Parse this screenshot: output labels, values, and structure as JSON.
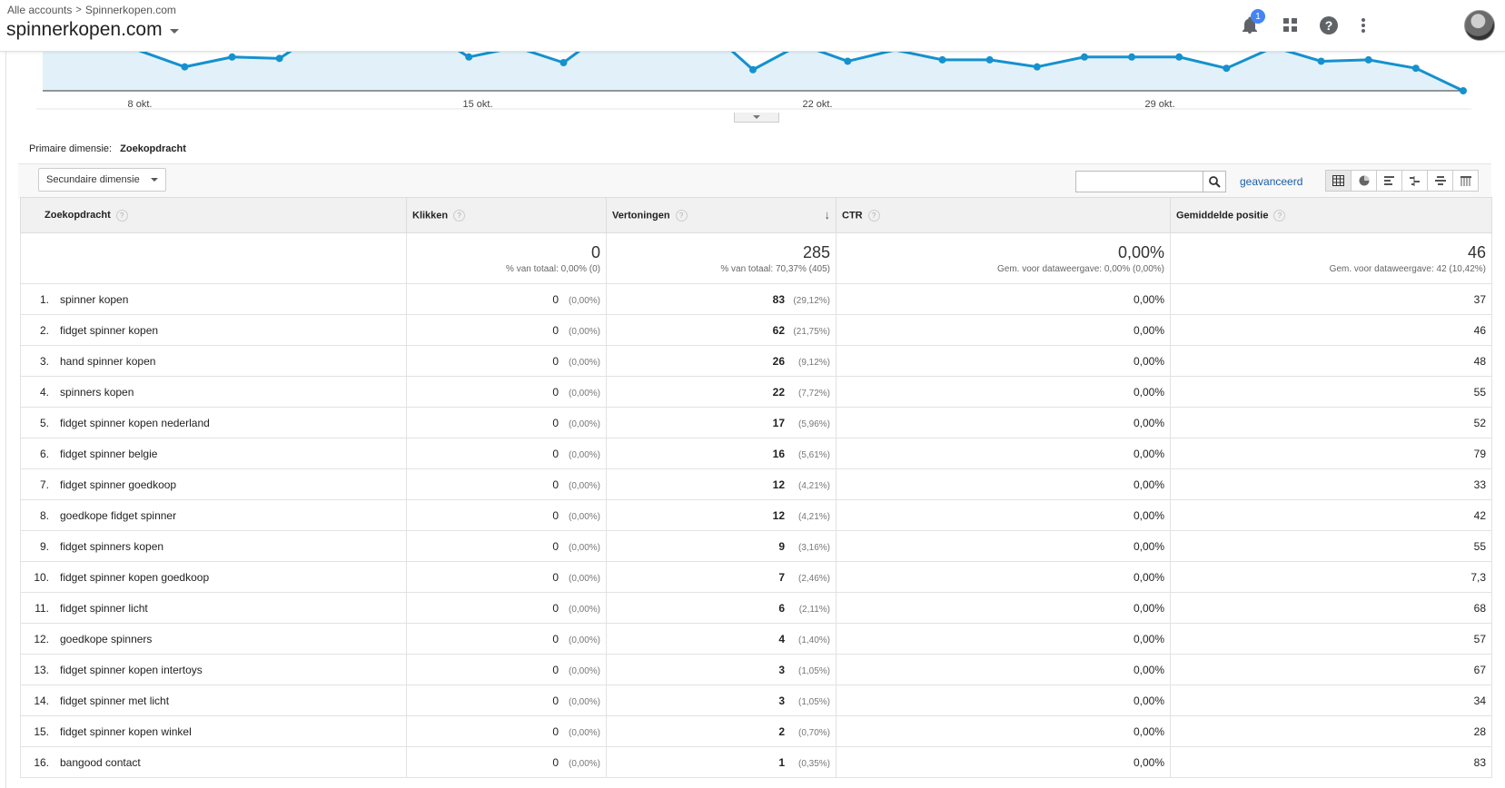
{
  "header": {
    "breadcrumb_root": "Alle accounts",
    "breadcrumb_property": "Spinnerkopen.com",
    "account_name": "spinnerkopen.com",
    "notification_count": "1"
  },
  "chart_data": {
    "type": "line",
    "x_ticks": [
      "8 okt.",
      "15 okt.",
      "22 okt.",
      "29 okt."
    ],
    "note_values": "relative heights of daily points (impressions); chart top is clipped",
    "values": [
      29,
      31,
      29,
      17,
      24,
      23,
      45,
      45,
      45,
      24,
      31,
      20,
      45,
      45,
      45,
      15,
      33,
      21,
      29,
      22,
      22,
      17,
      24,
      24,
      24,
      16,
      31,
      21,
      22,
      16,
      0
    ],
    "color": "#1591cf",
    "fill": "#e2f1f9"
  },
  "primary_dimension": {
    "label": "Primaire dimensie:",
    "value": "Zoekopdracht"
  },
  "toolbar": {
    "secondary_dimension": "Secundaire dimensie",
    "advanced": "geavanceerd",
    "search_placeholder": ""
  },
  "table": {
    "headers": {
      "query": "Zoekopdracht",
      "clicks": "Klikken",
      "impressions": "Vertoningen",
      "ctr": "CTR",
      "position": "Gemiddelde positie"
    },
    "totals": {
      "clicks": "0",
      "clicks_sub": "% van totaal: 0,00% (0)",
      "impressions": "285",
      "impressions_sub": "% van totaal: 70,37% (405)",
      "ctr": "0,00%",
      "ctr_sub": "Gem. voor dataweergave: 0,00% (0,00%)",
      "position": "46",
      "position_sub": "Gem. voor dataweergave: 42 (10,42%)"
    },
    "rows": [
      {
        "rank": "1.",
        "query": "spinner kopen",
        "clicks": "0",
        "clicks_pct": "(0,00%)",
        "imp": "83",
        "imp_pct": "(29,12%)",
        "ctr": "0,00%",
        "pos": "37"
      },
      {
        "rank": "2.",
        "query": "fidget spinner kopen",
        "clicks": "0",
        "clicks_pct": "(0,00%)",
        "imp": "62",
        "imp_pct": "(21,75%)",
        "ctr": "0,00%",
        "pos": "46"
      },
      {
        "rank": "3.",
        "query": "hand spinner kopen",
        "clicks": "0",
        "clicks_pct": "(0,00%)",
        "imp": "26",
        "imp_pct": "(9,12%)",
        "ctr": "0,00%",
        "pos": "48"
      },
      {
        "rank": "4.",
        "query": "spinners kopen",
        "clicks": "0",
        "clicks_pct": "(0,00%)",
        "imp": "22",
        "imp_pct": "(7,72%)",
        "ctr": "0,00%",
        "pos": "55"
      },
      {
        "rank": "5.",
        "query": "fidget spinner kopen nederland",
        "clicks": "0",
        "clicks_pct": "(0,00%)",
        "imp": "17",
        "imp_pct": "(5,96%)",
        "ctr": "0,00%",
        "pos": "52"
      },
      {
        "rank": "6.",
        "query": "fidget spinner belgie",
        "clicks": "0",
        "clicks_pct": "(0,00%)",
        "imp": "16",
        "imp_pct": "(5,61%)",
        "ctr": "0,00%",
        "pos": "79"
      },
      {
        "rank": "7.",
        "query": "fidget spinner goedkoop",
        "clicks": "0",
        "clicks_pct": "(0,00%)",
        "imp": "12",
        "imp_pct": "(4,21%)",
        "ctr": "0,00%",
        "pos": "33"
      },
      {
        "rank": "8.",
        "query": "goedkope fidget spinner",
        "clicks": "0",
        "clicks_pct": "(0,00%)",
        "imp": "12",
        "imp_pct": "(4,21%)",
        "ctr": "0,00%",
        "pos": "42"
      },
      {
        "rank": "9.",
        "query": "fidget spinners kopen",
        "clicks": "0",
        "clicks_pct": "(0,00%)",
        "imp": "9",
        "imp_pct": "(3,16%)",
        "ctr": "0,00%",
        "pos": "55"
      },
      {
        "rank": "10.",
        "query": "fidget spinner kopen goedkoop",
        "clicks": "0",
        "clicks_pct": "(0,00%)",
        "imp": "7",
        "imp_pct": "(2,46%)",
        "ctr": "0,00%",
        "pos": "7,3"
      },
      {
        "rank": "11.",
        "query": "fidget spinner licht",
        "clicks": "0",
        "clicks_pct": "(0,00%)",
        "imp": "6",
        "imp_pct": "(2,11%)",
        "ctr": "0,00%",
        "pos": "68"
      },
      {
        "rank": "12.",
        "query": "goedkope spinners",
        "clicks": "0",
        "clicks_pct": "(0,00%)",
        "imp": "4",
        "imp_pct": "(1,40%)",
        "ctr": "0,00%",
        "pos": "57"
      },
      {
        "rank": "13.",
        "query": "fidget spinner kopen intertoys",
        "clicks": "0",
        "clicks_pct": "(0,00%)",
        "imp": "3",
        "imp_pct": "(1,05%)",
        "ctr": "0,00%",
        "pos": "67"
      },
      {
        "rank": "14.",
        "query": "fidget spinner met licht",
        "clicks": "0",
        "clicks_pct": "(0,00%)",
        "imp": "3",
        "imp_pct": "(1,05%)",
        "ctr": "0,00%",
        "pos": "34"
      },
      {
        "rank": "15.",
        "query": "fidget spinner kopen winkel",
        "clicks": "0",
        "clicks_pct": "(0,00%)",
        "imp": "2",
        "imp_pct": "(0,70%)",
        "ctr": "0,00%",
        "pos": "28"
      },
      {
        "rank": "16.",
        "query": "bangood contact",
        "clicks": "0",
        "clicks_pct": "(0,00%)",
        "imp": "1",
        "imp_pct": "(0,35%)",
        "ctr": "0,00%",
        "pos": "83"
      }
    ]
  }
}
